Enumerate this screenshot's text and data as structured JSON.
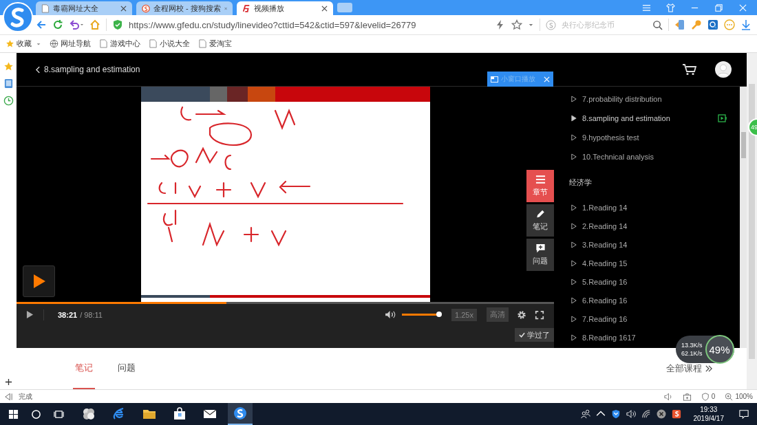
{
  "browser": {
    "tabs": [
      {
        "title": "毒霸网址大全",
        "kind": "page",
        "selected": false
      },
      {
        "title": "金程网校 - 搜狗搜索",
        "kind": "sogou",
        "selected": false
      },
      {
        "title": "视频播放",
        "kind": "site",
        "selected": true
      }
    ],
    "url": "https://www.gfedu.cn/study/linevideo?cttid=542&ctid=597&levelid=26779",
    "search": {
      "placeholder": "央行心形纪念币"
    },
    "bookmarks": [
      {
        "label": "收藏",
        "kind": "star"
      },
      {
        "label": "网址导航",
        "kind": "globe"
      },
      {
        "label": "游戏中心",
        "kind": "page"
      },
      {
        "label": "小说大全",
        "kind": "page"
      },
      {
        "label": "爱淘宝",
        "kind": "page"
      }
    ]
  },
  "page": {
    "title": "8.sampling and estimation",
    "mini_window": "小窗口播放",
    "side_buttons": [
      {
        "label": "章节",
        "kind": "list",
        "selected": true
      },
      {
        "label": "笔记",
        "kind": "pencil",
        "selected": false
      },
      {
        "label": "问题",
        "kind": "question",
        "selected": false
      }
    ],
    "player": {
      "progress": {
        "level": 0.39
      },
      "current_time": "38:21",
      "total_time": "/ 98:11",
      "volume": {
        "level": 0.95
      },
      "speed": "1.25x",
      "quality": "高清",
      "learned_button": "学过了"
    },
    "chapters": [
      {
        "items": [
          {
            "label": "7.probability distribution",
            "selected": false
          },
          {
            "label": "8.sampling and estimation",
            "selected": true
          },
          {
            "label": "9.hypothesis test",
            "selected": false
          },
          {
            "label": "10.Technical analysis",
            "selected": false
          }
        ]
      },
      {
        "title": "经济学",
        "items": [
          {
            "label": "1.Reading 14",
            "selected": false
          },
          {
            "label": "2.Reading 14",
            "selected": false
          },
          {
            "label": "3.Reading 14",
            "selected": false
          },
          {
            "label": "4.Reading 15",
            "selected": false
          },
          {
            "label": "5.Reading 16",
            "selected": false
          },
          {
            "label": "6.Reading 16",
            "selected": false
          },
          {
            "label": "7.Reading 16",
            "selected": false
          },
          {
            "label": "8.Reading 1617",
            "selected": false
          }
        ]
      }
    ],
    "content_tabs": [
      {
        "label": "笔记",
        "selected": true
      },
      {
        "label": "问题",
        "selected": false
      }
    ],
    "all_courses": "全部课程"
  },
  "status_bar": {
    "status": "完成",
    "ad_count": "0",
    "zoom": "100%"
  },
  "speed_widget": {
    "upload": "13.3K/s",
    "download": "62.1K/s",
    "percent": "49%"
  },
  "edge_badge": "49",
  "taskbar": {
    "apps": [
      {
        "kind": "cloud",
        "selected": false
      },
      {
        "kind": "ie",
        "selected": false
      },
      {
        "kind": "folder",
        "selected": false
      },
      {
        "kind": "store",
        "selected": false
      },
      {
        "kind": "mail",
        "selected": false
      },
      {
        "kind": "sogou",
        "selected": true
      }
    ],
    "time": "19:33",
    "date": "2019/4/17"
  }
}
